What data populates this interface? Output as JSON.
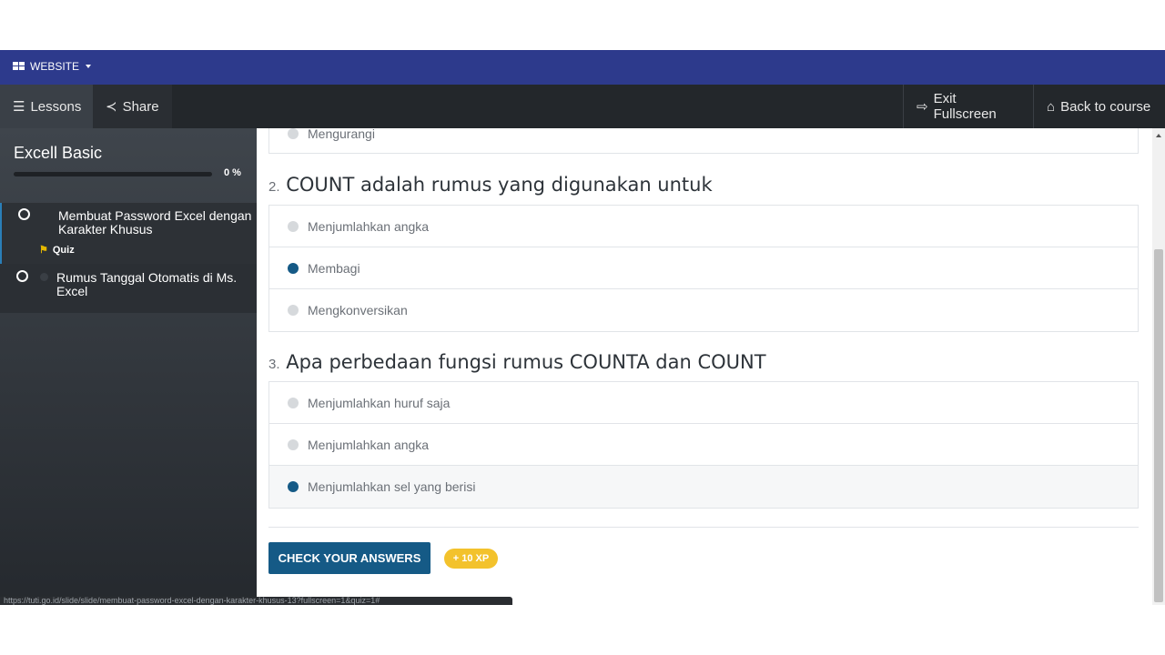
{
  "topbar": {
    "menu_label": "WEBSITE"
  },
  "toolbar": {
    "lessons_label": "Lessons",
    "share_label": "Share",
    "exit_label": "Exit Fullscreen",
    "back_label": "Back to course"
  },
  "sidebar": {
    "course_title": "Excell Basic",
    "progress_percent": 0,
    "progress_text": "0 %",
    "lessons": [
      {
        "title": "Membuat Password Excel dengan Karakter Khusus",
        "tag": "Quiz",
        "active": true
      },
      {
        "title": "Rumus Tanggal Otomatis di Ms. Excel",
        "active": false
      }
    ]
  },
  "status_url": "https://tuti.go.id/slide/slide/membuat-password-excel-dengan-karakter-khusus-13?fullscreen=1&quiz=1#",
  "quiz": {
    "q1_partial_option": "Mengurangi",
    "questions": [
      {
        "number": "2.",
        "text": "COUNT adalah rumus yang digunakan untuk",
        "options": [
          "Menjumlahkan angka",
          "Membagi",
          "Mengkonversikan"
        ],
        "selected_index": 1
      },
      {
        "number": "3.",
        "text": "Apa perbedaan fungsi rumus COUNTA dan COUNT",
        "options": [
          "Menjumlahkan huruf saja",
          "Menjumlahkan angka",
          "Menjumlahkan sel yang berisi"
        ],
        "selected_index": 2
      }
    ],
    "check_button": "CHECK YOUR ANSWERS",
    "xp_badge": "+ 10 XP"
  },
  "colors": {
    "topbar": "#2d3a8c",
    "darkbar": "#23272b",
    "accent": "#155a86",
    "xp": "#f3c22c"
  }
}
